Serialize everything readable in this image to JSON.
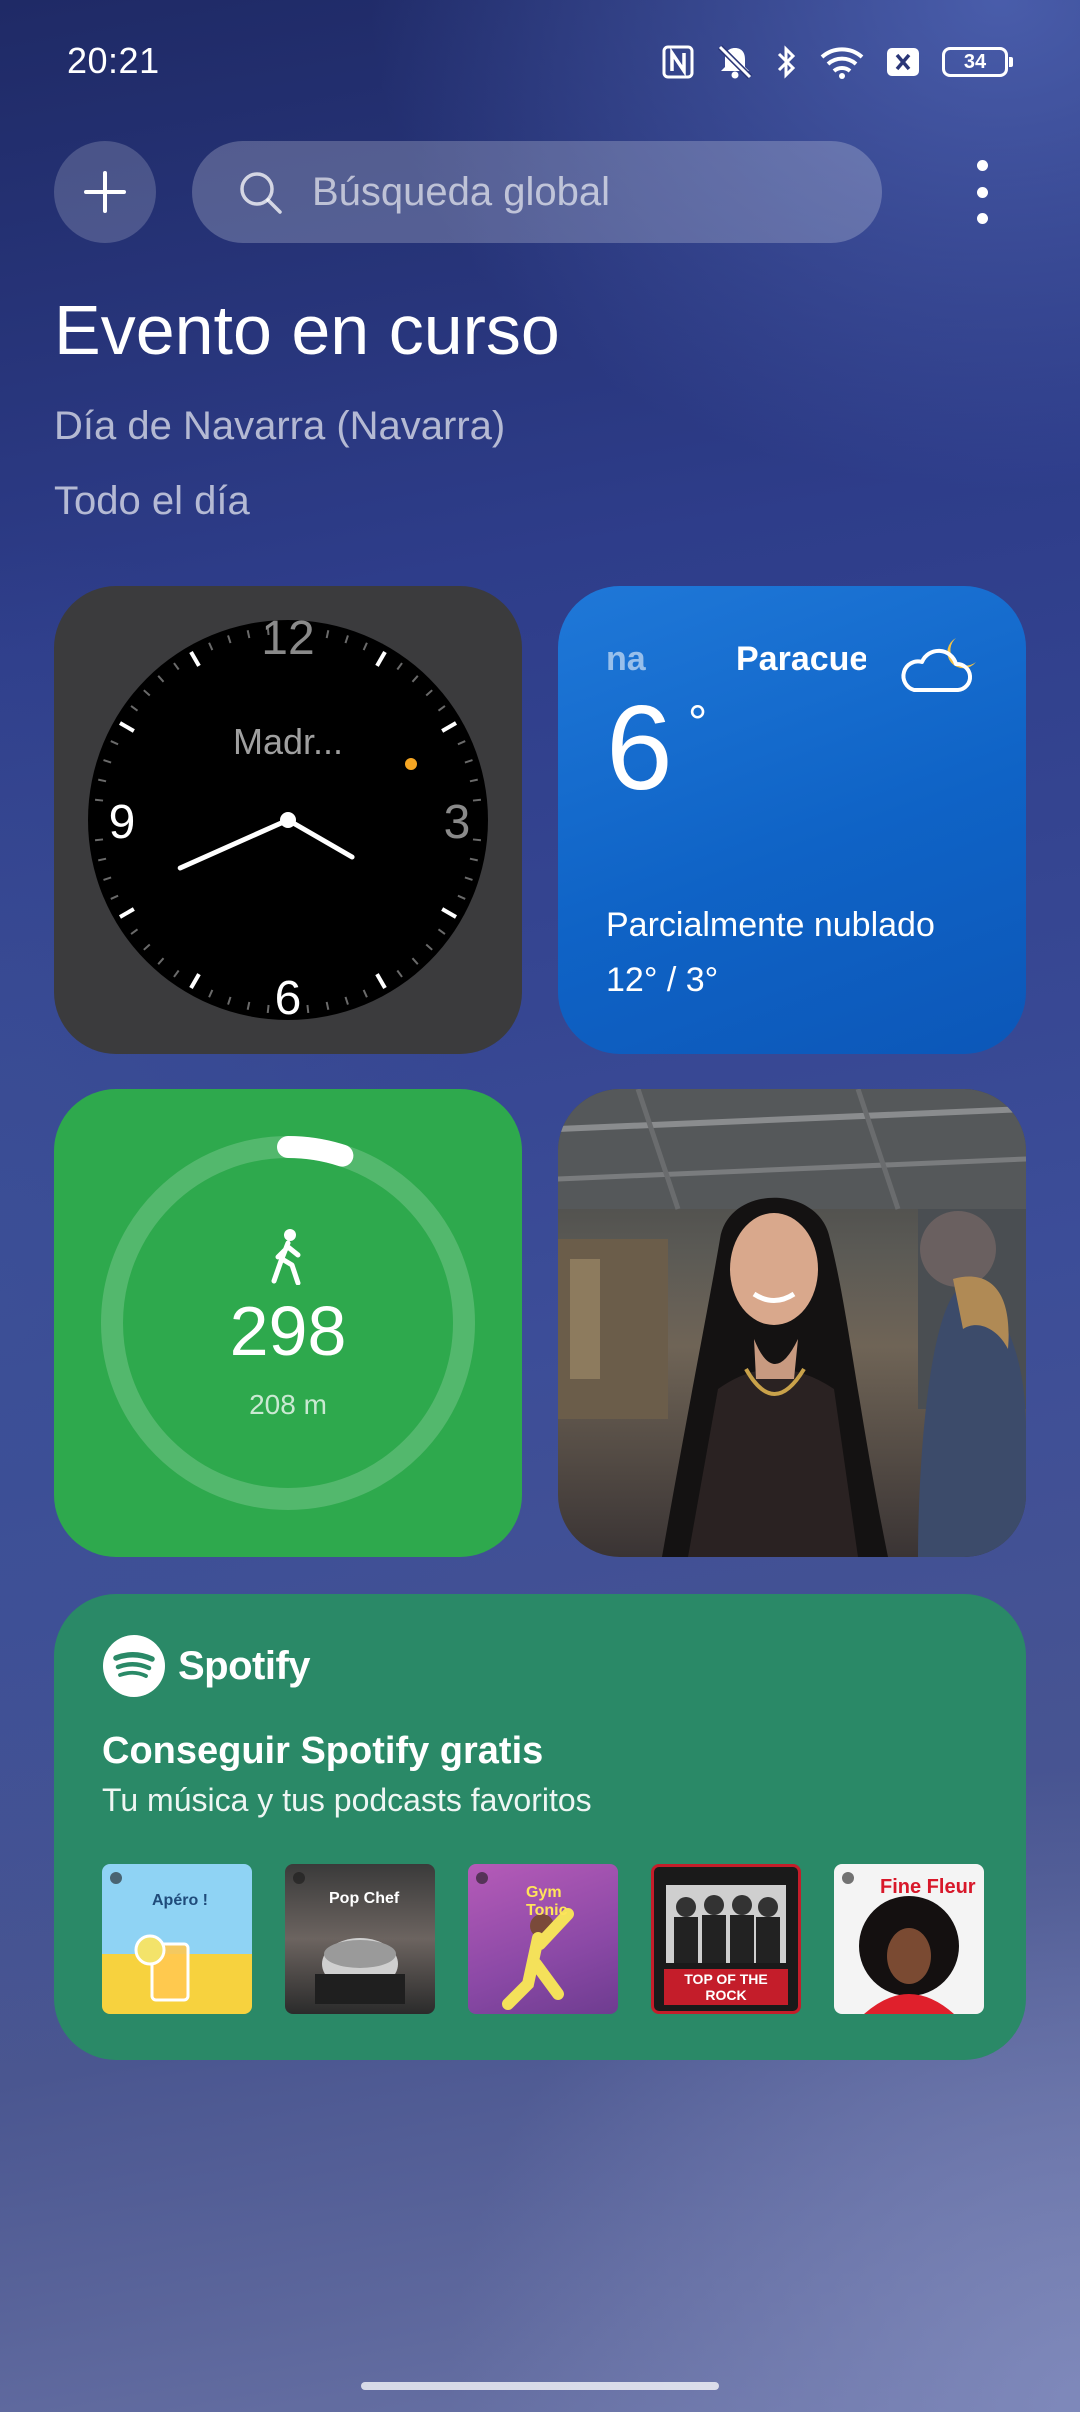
{
  "status_bar": {
    "time": "20:21",
    "battery": "34"
  },
  "search": {
    "placeholder": "Búsqueda global"
  },
  "event": {
    "title": "Evento en curso",
    "name": "Día de Navarra (Navarra)",
    "time": "Todo el día"
  },
  "clock": {
    "city": "Madr...",
    "numbers": [
      "12",
      "3",
      "6",
      "9"
    ],
    "hour_hand_angle_deg": 120,
    "minute_hand_angle_deg": 246
  },
  "weather": {
    "location_fragment": "na",
    "location": "Paracuel",
    "temperature": "6",
    "degree_symbol": "°",
    "description": "Parcialmente nublado",
    "range": "12° / 3°",
    "icon": "partly-cloudy-night-icon"
  },
  "steps": {
    "count": "298",
    "distance": "208 m",
    "goal_progress": 0.05,
    "icon": "walking-icon"
  },
  "photo": {
    "icon": "photo-portrait"
  },
  "spotify": {
    "brand": "Spotify",
    "title": "Conseguir Spotify gratis",
    "subtitle": "Tu música y tus podcasts favoritos",
    "covers": [
      {
        "label": "Apéro !"
      },
      {
        "label": "Pop Chef"
      },
      {
        "label": "Gym Tonic"
      },
      {
        "label": "TOP OF THE ROCK"
      },
      {
        "label": "Fine Fleur"
      }
    ]
  },
  "colors": {
    "weather_bg": "#1670d0",
    "steps_bg": "#2ea94d",
    "spotify_bg": "#2a8967",
    "clock_bg": "#3b3b3d",
    "clock_accent_dot": "#f5a623"
  }
}
